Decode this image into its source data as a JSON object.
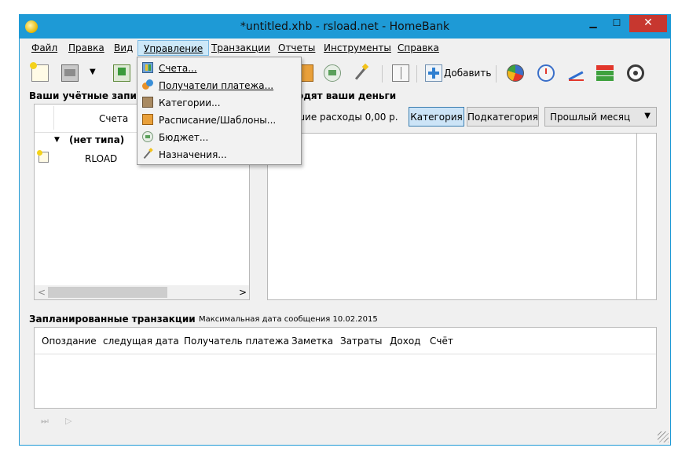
{
  "window": {
    "title": "*untitled.xhb - rsload.net - HomeBank",
    "min_glyph": "▁",
    "max_glyph": "☐",
    "close_glyph": "✕"
  },
  "menubar": {
    "items": [
      {
        "label": "Файл"
      },
      {
        "label": "Правка"
      },
      {
        "label": "Вид"
      },
      {
        "label": "Управление"
      },
      {
        "label": "Транзакции"
      },
      {
        "label": "Отчеты"
      },
      {
        "label": "Инструменты"
      },
      {
        "label": "Справка"
      }
    ]
  },
  "toolbar": {
    "add_label": "Добавить",
    "open_arrow": "▼"
  },
  "dropdown": {
    "items": [
      {
        "label": "Счета..."
      },
      {
        "label": "Получатели платежа..."
      },
      {
        "label": "Категории..."
      },
      {
        "label": "Расписание/Шаблоны..."
      },
      {
        "label": "Бюджет..."
      },
      {
        "label": "Назначения..."
      }
    ]
  },
  "accounts": {
    "title": "Ваши учётные запис",
    "column_header": "Счета",
    "group_label": "(нет типа)",
    "group_arrow": "▼",
    "rows": [
      {
        "name": "RLOAD"
      }
    ],
    "scroll_left": "<",
    "scroll_right": ">"
  },
  "spending": {
    "title": "одят ваши деньги",
    "summary": "ьшие расходы 0,00 р.",
    "btn_category": "Категория",
    "btn_subcategory": "Подкатегория",
    "period_value": "Прошлый месяц",
    "period_arrow": "▼"
  },
  "scheduled": {
    "title": "Запланированные транзакции",
    "subtitle": "Максимальная дата сообщения  10.02.2015",
    "columns": [
      "Опоздание",
      "следущая дата",
      "Получатель платежа",
      "Заметка",
      "Затраты",
      "Доход",
      "Счёт"
    ],
    "skip_glyph": "⏭",
    "post_glyph": "▷"
  },
  "colors": {
    "titlebar": "#1e9ad6",
    "close": "#c7372f",
    "menu_active": "#cde8f8",
    "button_active": "#cce4f7"
  }
}
